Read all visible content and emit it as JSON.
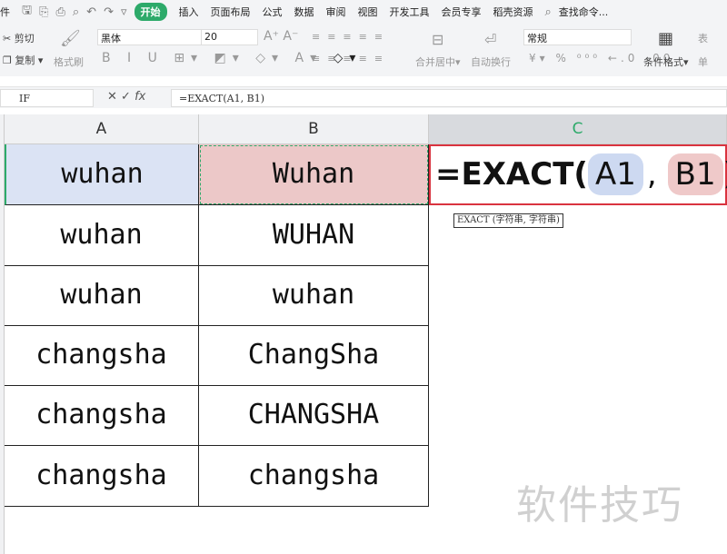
{
  "menu": {
    "file": "件",
    "tabs": [
      "开始",
      "插入",
      "页面布局",
      "公式",
      "数据",
      "审阅",
      "视图",
      "开发工具",
      "会员专享",
      "稻壳资源"
    ],
    "search": "查找命令..."
  },
  "ribbon": {
    "cut": "剪切",
    "copy": "复制",
    "format_painter": "格式刷",
    "font": "黑体",
    "size": "20",
    "merge": "合并居中",
    "wrap": "自动换行",
    "number_format": "常规",
    "cond_format": "条件格式",
    "table_style": "表",
    "cell_style": "单"
  },
  "formula_bar": {
    "name_box": "IF",
    "formula": "=EXACT(A1, B1)"
  },
  "columns": [
    "A",
    "B",
    "C"
  ],
  "rows": [
    [
      "wuhan",
      "Wuhan"
    ],
    [
      "wuhan",
      "WUHAN"
    ],
    [
      "wuhan",
      "wuhan"
    ],
    [
      "changsha",
      "ChangSha"
    ],
    [
      "changsha",
      "CHANGSHA"
    ],
    [
      "changsha",
      "changsha"
    ]
  ],
  "editor": {
    "prefix": "=EXACT(",
    "arg1": "A1",
    "sep": ",",
    "arg2": "B1",
    "suffix": ")"
  },
  "tooltip": "EXACT (字符串, 字符串)",
  "watermark": "软件技巧"
}
